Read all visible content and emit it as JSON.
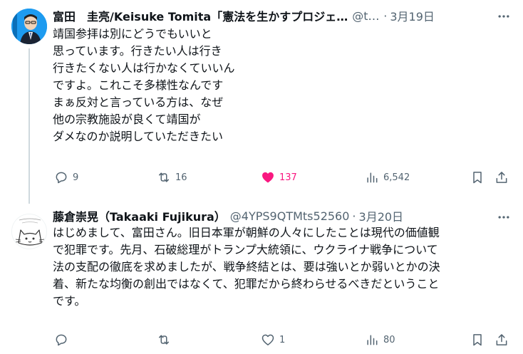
{
  "colors": {
    "text_primary": "#0f1419",
    "text_secondary": "#536471",
    "like_active": "#f91880",
    "thread_line": "#cfd9de",
    "avatar1_bg": "#1d9bf0"
  },
  "post1": {
    "name": "富田　圭亮/Keisuke Tomita「憲法を生かすプロジェ…",
    "handle": "@to…",
    "date": "3月19日",
    "lines": [
      "靖国参拝は別にどうでもいいと",
      "思っています。行きたい人は行き",
      "行きたくない人は行かなくていいん",
      "ですよ。これこそ多様性なんです",
      "まぁ反対と言っている方は、なぜ",
      "他の宗教施設が良くて靖国が",
      "ダメなのか説明していただきたい"
    ],
    "metrics": {
      "replies": "9",
      "reposts": "16",
      "likes": "137",
      "views": "6,542"
    },
    "liked": true,
    "icons": [
      "more-icon",
      "reply-icon",
      "repost-icon",
      "heart-filled-icon",
      "views-icon",
      "bookmark-icon",
      "share-icon"
    ]
  },
  "post2": {
    "name": "藤倉崇晃（Takaaki Fujikura）",
    "handle": "@4YPS9QTMts52560",
    "date": "3月20日",
    "lines": [
      "はじめまして、富田さん。旧日本軍が朝鮮の人々にしたことは現代の価値観",
      "で犯罪です。先月、石破総理がトランプ大統領に、ウクライナ戦争について",
      "法の支配の徹底を求めましたが、戦争終結とは、要は強いとか弱いとかの決",
      "着、新たな均衡の創出ではなくて、犯罪だから終わらせるべきだということ",
      "です。"
    ],
    "metrics": {
      "replies": "",
      "reposts": "",
      "likes": "1",
      "views": "80"
    },
    "liked": false,
    "icons": [
      "more-icon",
      "reply-icon",
      "repost-icon",
      "heart-outline-icon",
      "views-icon",
      "bookmark-icon",
      "share-icon"
    ]
  }
}
